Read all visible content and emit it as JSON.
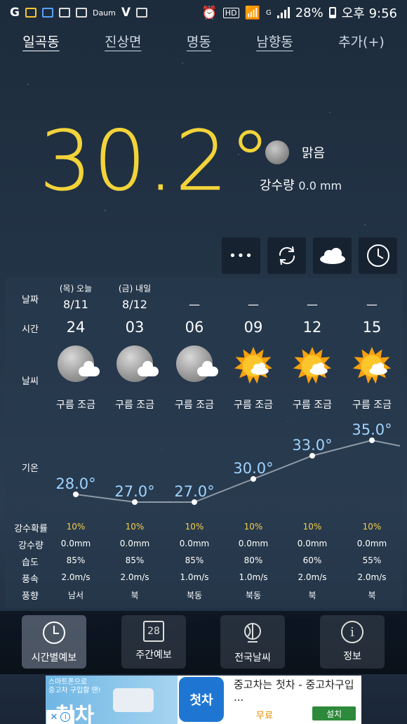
{
  "status_bar": {
    "battery": "28%",
    "time": "오후 9:56",
    "network": "G"
  },
  "tabs": [
    {
      "label": "일곡동",
      "active": true
    },
    {
      "label": "진상면",
      "active": false
    },
    {
      "label": "명동",
      "active": false
    },
    {
      "label": "남향동",
      "active": false
    },
    {
      "label": "추가(+)",
      "active": false
    }
  ],
  "current": {
    "temperature": "30.2°",
    "condition": "맑음",
    "rain_label": "강수량",
    "rain_value": "0.0 mm",
    "condition_icon": "moon-icon"
  },
  "actions": [
    {
      "icon": "more-icon",
      "glyph": "•••"
    },
    {
      "icon": "refresh-icon",
      "glyph": "⟳"
    },
    {
      "icon": "cloud-icon",
      "glyph": "☁"
    },
    {
      "icon": "clock-icon",
      "glyph": "◷"
    }
  ],
  "forecast": {
    "labels": {
      "date": "날짜",
      "time": "시간",
      "weather": "날씨",
      "temperature": "기온",
      "pop": "강수확률",
      "rain": "강수량",
      "humidity": "습도",
      "wind_speed": "풍속",
      "wind_dir": "풍향"
    },
    "columns": [
      {
        "day": "(목) 오늘",
        "date": "8/11",
        "hour": "24",
        "icon": "moon-cloud-icon",
        "desc": "구름 조금",
        "temp": "28.0°",
        "temp_value": 28.0,
        "pop": "10%",
        "rain": "0.0mm",
        "humidity": "85%",
        "wind": "2.0m/s",
        "dir": "남서"
      },
      {
        "day": "(금) 내일",
        "date": "8/12",
        "hour": "03",
        "icon": "moon-cloud-icon",
        "desc": "구름 조금",
        "temp": "27.0°",
        "temp_value": 27.0,
        "pop": "10%",
        "rain": "0.0mm",
        "humidity": "85%",
        "wind": "2.0m/s",
        "dir": "북"
      },
      {
        "day": "",
        "date": "—",
        "hour": "06",
        "icon": "moon-cloud-icon",
        "desc": "구름 조금",
        "temp": "27.0°",
        "temp_value": 27.0,
        "pop": "10%",
        "rain": "0.0mm",
        "humidity": "85%",
        "wind": "1.0m/s",
        "dir": "북동"
      },
      {
        "day": "",
        "date": "—",
        "hour": "09",
        "icon": "sun-cloud-icon",
        "desc": "구름 조금",
        "temp": "30.0°",
        "temp_value": 30.0,
        "pop": "10%",
        "rain": "0.0mm",
        "humidity": "80%",
        "wind": "1.0m/s",
        "dir": "북동"
      },
      {
        "day": "",
        "date": "—",
        "hour": "12",
        "icon": "sun-cloud-icon",
        "desc": "구름 조금",
        "temp": "33.0°",
        "temp_value": 33.0,
        "pop": "10%",
        "rain": "0.0mm",
        "humidity": "60%",
        "wind": "2.0m/s",
        "dir": "북"
      },
      {
        "day": "",
        "date": "—",
        "hour": "15",
        "icon": "sun-cloud-icon",
        "desc": "구름 조금",
        "temp": "35.0°",
        "temp_value": 35.0,
        "pop": "10%",
        "rain": "0.0mm",
        "humidity": "55%",
        "wind": "2.0m/s",
        "dir": "북"
      }
    ]
  },
  "bottom_nav": [
    {
      "label": "시간별예보",
      "icon": "clock-icon",
      "active": true
    },
    {
      "label": "주간예보",
      "icon": "calendar-icon",
      "glyph": "28",
      "active": false
    },
    {
      "label": "전국날씨",
      "icon": "globe-icon",
      "active": false
    },
    {
      "label": "정보",
      "icon": "info-icon",
      "glyph": "i",
      "active": false
    }
  ],
  "ad": {
    "banner_line1": "스마트폰으로",
    "banner_line2": "중고차 구입할 땐!",
    "banner_brand": "첫차",
    "logo": "첫차",
    "title": "중고차는 첫차 - 중고차구입 ...",
    "price": "무료",
    "install": "설치"
  },
  "colors": {
    "temperature": "#f3d33a",
    "pop": "#f4cf4a",
    "temp_label": "#9fd3ff"
  }
}
